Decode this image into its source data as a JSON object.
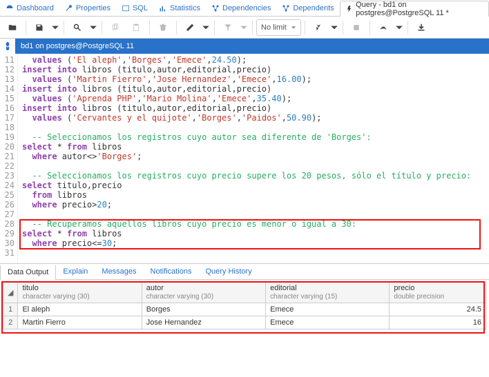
{
  "tabs": [
    {
      "label": "Dashboard",
      "icon": "dashboard"
    },
    {
      "label": "Properties",
      "icon": "wrench"
    },
    {
      "label": "SQL",
      "icon": "sql"
    },
    {
      "label": "Statistics",
      "icon": "chart"
    },
    {
      "label": "Dependencies",
      "icon": "deps"
    },
    {
      "label": "Dependents",
      "icon": "deps"
    },
    {
      "label": "Query - bd1 on postgres@PostgreSQL 11 *",
      "icon": "bolt",
      "active": true
    }
  ],
  "toolbar": {
    "limit": "No limit"
  },
  "connection": "bd1 on postgres@PostgreSQL 11",
  "code": {
    "start": 11,
    "lines": [
      [
        [
          "",
          "  "
        ],
        [
          "kw",
          "values"
        ],
        [
          "",
          " ("
        ],
        [
          "str",
          "'El aleph'"
        ],
        [
          "",
          ","
        ],
        [
          "str",
          "'Borges'"
        ],
        [
          "",
          ","
        ],
        [
          "str",
          "'Emece'"
        ],
        [
          "",
          ","
        ],
        [
          "num",
          "24.50"
        ],
        [
          "",
          ");"
        ]
      ],
      [
        [
          "",
          ""
        ],
        [
          "kw",
          "insert into"
        ],
        [
          "",
          " libros (titulo,autor,editorial,precio)"
        ]
      ],
      [
        [
          "",
          "  "
        ],
        [
          "kw",
          "values"
        ],
        [
          "",
          " ("
        ],
        [
          "str",
          "'Martin Fierro'"
        ],
        [
          "",
          ","
        ],
        [
          "str",
          "'Jose Hernandez'"
        ],
        [
          "",
          ","
        ],
        [
          "str",
          "'Emece'"
        ],
        [
          "",
          ","
        ],
        [
          "num",
          "16.00"
        ],
        [
          "",
          ");"
        ]
      ],
      [
        [
          "",
          ""
        ],
        [
          "kw",
          "insert into"
        ],
        [
          "",
          " libros (titulo,autor,editorial,precio)"
        ]
      ],
      [
        [
          "",
          "  "
        ],
        [
          "kw",
          "values"
        ],
        [
          "",
          " ("
        ],
        [
          "str",
          "'Aprenda PHP'"
        ],
        [
          "",
          ","
        ],
        [
          "str",
          "'Mario Molina'"
        ],
        [
          "",
          ","
        ],
        [
          "str",
          "'Emece'"
        ],
        [
          "",
          ","
        ],
        [
          "num",
          "35.40"
        ],
        [
          "",
          ");"
        ]
      ],
      [
        [
          "",
          ""
        ],
        [
          "kw",
          "insert into"
        ],
        [
          "",
          " libros (titulo,autor,editorial,precio)"
        ]
      ],
      [
        [
          "",
          "  "
        ],
        [
          "kw",
          "values"
        ],
        [
          "",
          " ("
        ],
        [
          "str",
          "'Cervantes y el quijote'"
        ],
        [
          "",
          ","
        ],
        [
          "str",
          "'Borges'"
        ],
        [
          "",
          ","
        ],
        [
          "str",
          "'Paidos'"
        ],
        [
          "",
          ","
        ],
        [
          "num",
          "50.90"
        ],
        [
          "",
          ");"
        ]
      ],
      [],
      [
        [
          "",
          "  "
        ],
        [
          "cmt",
          "-- Seleccionamos los registros cuyo autor sea diferente de 'Borges':"
        ]
      ],
      [
        [
          "",
          ""
        ],
        [
          "kw",
          "select"
        ],
        [
          "",
          " * "
        ],
        [
          "kw",
          "from"
        ],
        [
          "",
          " libros"
        ]
      ],
      [
        [
          "",
          "  "
        ],
        [
          "kw",
          "where"
        ],
        [
          "",
          " autor<>"
        ],
        [
          "str",
          "'Borges'"
        ],
        [
          "",
          ";"
        ]
      ],
      [],
      [
        [
          "",
          "  "
        ],
        [
          "cmt",
          "-- Seleccionamos los registros cuyo precio supere los 20 pesos, sólo el título y precio:"
        ]
      ],
      [
        [
          "",
          ""
        ],
        [
          "kw",
          "select"
        ],
        [
          "",
          " titulo,precio"
        ]
      ],
      [
        [
          "",
          "  "
        ],
        [
          "kw",
          "from"
        ],
        [
          "",
          " libros"
        ]
      ],
      [
        [
          "",
          "  "
        ],
        [
          "kw",
          "where"
        ],
        [
          "",
          " precio>"
        ],
        [
          "num",
          "20"
        ],
        [
          "",
          ";"
        ]
      ],
      [],
      [
        [
          "",
          "  "
        ],
        [
          "cmt",
          "-- Recuperamos aquellos libros cuyo precio es menor o igual a 30:"
        ]
      ],
      [
        [
          "",
          ""
        ],
        [
          "kw",
          "select"
        ],
        [
          "",
          " * "
        ],
        [
          "kw",
          "from"
        ],
        [
          "",
          " libros"
        ]
      ],
      [
        [
          "",
          "  "
        ],
        [
          "kw",
          "where"
        ],
        [
          "",
          " precio<="
        ],
        [
          "num",
          "30"
        ],
        [
          "",
          ";"
        ]
      ],
      []
    ]
  },
  "output_tabs": [
    "Data Output",
    "Explain",
    "Messages",
    "Notifications",
    "Query History"
  ],
  "grid": {
    "columns": [
      {
        "name": "titulo",
        "type": "character varying (30)"
      },
      {
        "name": "autor",
        "type": "character varying (30)"
      },
      {
        "name": "editorial",
        "type": "character varying (15)"
      },
      {
        "name": "precio",
        "type": "double precision"
      }
    ],
    "rows": [
      [
        "El aleph",
        "Borges",
        "Emece",
        "24.5"
      ],
      [
        "Martin Fierro",
        "Jose Hernandez",
        "Emece",
        "16"
      ]
    ]
  }
}
